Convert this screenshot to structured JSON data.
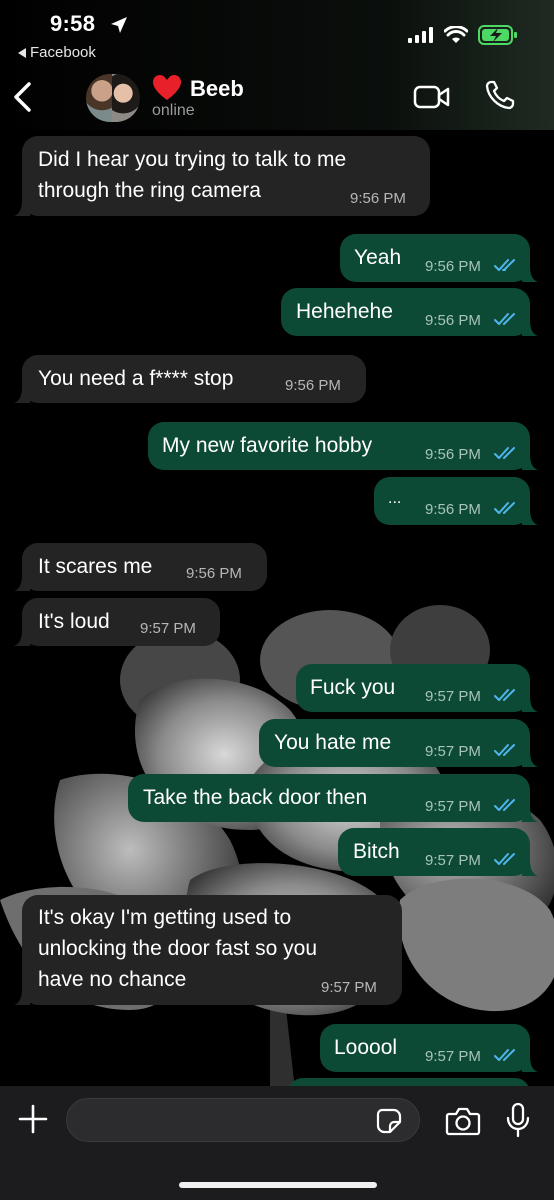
{
  "status_bar": {
    "time": "9:58",
    "back_app": "Facebook"
  },
  "header": {
    "contact_name": "Beeb",
    "contact_status": "online"
  },
  "messages": [
    {
      "direction": "in",
      "lines": [
        "Did I hear you trying to talk to me",
        "through the ring camera"
      ],
      "time": "9:56 PM"
    },
    {
      "direction": "out",
      "text": "Yeah",
      "time": "9:56 PM"
    },
    {
      "direction": "out",
      "text": "Hehehehe",
      "time": "9:56 PM"
    },
    {
      "direction": "in",
      "text": "You need a f**** stop",
      "time": "9:56 PM"
    },
    {
      "direction": "out",
      "text": "My new favorite hobby",
      "time": "9:56 PM"
    },
    {
      "direction": "out",
      "text": "...",
      "time": "9:56 PM"
    },
    {
      "direction": "in",
      "text": "It scares me",
      "time": "9:56 PM"
    },
    {
      "direction": "in",
      "text": "It's loud",
      "time": "9:57 PM"
    },
    {
      "direction": "out",
      "text": "Fuck you",
      "time": "9:57 PM"
    },
    {
      "direction": "out",
      "text": "You hate me",
      "time": "9:57 PM"
    },
    {
      "direction": "out",
      "text": "Take the back door then",
      "time": "9:57 PM"
    },
    {
      "direction": "out",
      "text": "Bitch",
      "time": "9:57 PM"
    },
    {
      "direction": "in",
      "lines": [
        "It's okay I'm getting used to",
        "unlocking the door fast so you",
        "have no chance"
      ],
      "time": "9:57 PM"
    },
    {
      "direction": "out",
      "text": "Looool",
      "time": "9:57 PM"
    }
  ],
  "input": {
    "value": "",
    "placeholder": ""
  },
  "icons": {
    "location": "location-arrow-icon",
    "signal": "cellular-signal-icon",
    "wifi": "wifi-icon",
    "battery": "battery-charging-icon",
    "back": "chevron-left-icon",
    "heart": "heart-icon",
    "video": "video-camera-icon",
    "phone": "phone-icon",
    "plus": "plus-icon",
    "sticker": "sticker-icon",
    "camera": "camera-icon",
    "mic": "microphone-icon",
    "read": "double-check-icon"
  },
  "colors": {
    "outgoing_bubble": "#0d4a36",
    "incoming_bubble": "#242424",
    "read_ticks": "#4fb6ec",
    "battery": "#4cd964",
    "heart": "#e8202a"
  }
}
